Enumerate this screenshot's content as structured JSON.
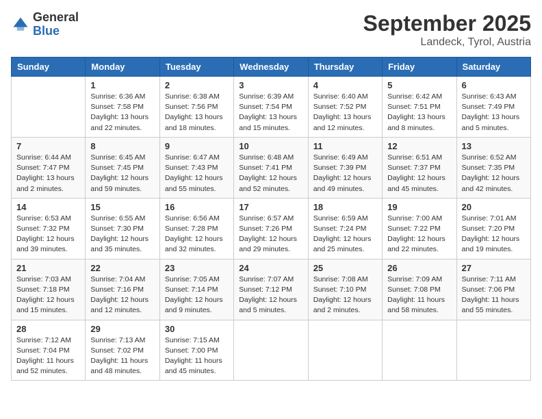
{
  "header": {
    "logo_general": "General",
    "logo_blue": "Blue",
    "month": "September 2025",
    "location": "Landeck, Tyrol, Austria"
  },
  "weekdays": [
    "Sunday",
    "Monday",
    "Tuesday",
    "Wednesday",
    "Thursday",
    "Friday",
    "Saturday"
  ],
  "weeks": [
    [
      {
        "day": "",
        "sunrise": "",
        "sunset": "",
        "daylight": ""
      },
      {
        "day": "1",
        "sunrise": "Sunrise: 6:36 AM",
        "sunset": "Sunset: 7:58 PM",
        "daylight": "Daylight: 13 hours and 22 minutes."
      },
      {
        "day": "2",
        "sunrise": "Sunrise: 6:38 AM",
        "sunset": "Sunset: 7:56 PM",
        "daylight": "Daylight: 13 hours and 18 minutes."
      },
      {
        "day": "3",
        "sunrise": "Sunrise: 6:39 AM",
        "sunset": "Sunset: 7:54 PM",
        "daylight": "Daylight: 13 hours and 15 minutes."
      },
      {
        "day": "4",
        "sunrise": "Sunrise: 6:40 AM",
        "sunset": "Sunset: 7:52 PM",
        "daylight": "Daylight: 13 hours and 12 minutes."
      },
      {
        "day": "5",
        "sunrise": "Sunrise: 6:42 AM",
        "sunset": "Sunset: 7:51 PM",
        "daylight": "Daylight: 13 hours and 8 minutes."
      },
      {
        "day": "6",
        "sunrise": "Sunrise: 6:43 AM",
        "sunset": "Sunset: 7:49 PM",
        "daylight": "Daylight: 13 hours and 5 minutes."
      }
    ],
    [
      {
        "day": "7",
        "sunrise": "Sunrise: 6:44 AM",
        "sunset": "Sunset: 7:47 PM",
        "daylight": "Daylight: 13 hours and 2 minutes."
      },
      {
        "day": "8",
        "sunrise": "Sunrise: 6:45 AM",
        "sunset": "Sunset: 7:45 PM",
        "daylight": "Daylight: 12 hours and 59 minutes."
      },
      {
        "day": "9",
        "sunrise": "Sunrise: 6:47 AM",
        "sunset": "Sunset: 7:43 PM",
        "daylight": "Daylight: 12 hours and 55 minutes."
      },
      {
        "day": "10",
        "sunrise": "Sunrise: 6:48 AM",
        "sunset": "Sunset: 7:41 PM",
        "daylight": "Daylight: 12 hours and 52 minutes."
      },
      {
        "day": "11",
        "sunrise": "Sunrise: 6:49 AM",
        "sunset": "Sunset: 7:39 PM",
        "daylight": "Daylight: 12 hours and 49 minutes."
      },
      {
        "day": "12",
        "sunrise": "Sunrise: 6:51 AM",
        "sunset": "Sunset: 7:37 PM",
        "daylight": "Daylight: 12 hours and 45 minutes."
      },
      {
        "day": "13",
        "sunrise": "Sunrise: 6:52 AM",
        "sunset": "Sunset: 7:35 PM",
        "daylight": "Daylight: 12 hours and 42 minutes."
      }
    ],
    [
      {
        "day": "14",
        "sunrise": "Sunrise: 6:53 AM",
        "sunset": "Sunset: 7:32 PM",
        "daylight": "Daylight: 12 hours and 39 minutes."
      },
      {
        "day": "15",
        "sunrise": "Sunrise: 6:55 AM",
        "sunset": "Sunset: 7:30 PM",
        "daylight": "Daylight: 12 hours and 35 minutes."
      },
      {
        "day": "16",
        "sunrise": "Sunrise: 6:56 AM",
        "sunset": "Sunset: 7:28 PM",
        "daylight": "Daylight: 12 hours and 32 minutes."
      },
      {
        "day": "17",
        "sunrise": "Sunrise: 6:57 AM",
        "sunset": "Sunset: 7:26 PM",
        "daylight": "Daylight: 12 hours and 29 minutes."
      },
      {
        "day": "18",
        "sunrise": "Sunrise: 6:59 AM",
        "sunset": "Sunset: 7:24 PM",
        "daylight": "Daylight: 12 hours and 25 minutes."
      },
      {
        "day": "19",
        "sunrise": "Sunrise: 7:00 AM",
        "sunset": "Sunset: 7:22 PM",
        "daylight": "Daylight: 12 hours and 22 minutes."
      },
      {
        "day": "20",
        "sunrise": "Sunrise: 7:01 AM",
        "sunset": "Sunset: 7:20 PM",
        "daylight": "Daylight: 12 hours and 19 minutes."
      }
    ],
    [
      {
        "day": "21",
        "sunrise": "Sunrise: 7:03 AM",
        "sunset": "Sunset: 7:18 PM",
        "daylight": "Daylight: 12 hours and 15 minutes."
      },
      {
        "day": "22",
        "sunrise": "Sunrise: 7:04 AM",
        "sunset": "Sunset: 7:16 PM",
        "daylight": "Daylight: 12 hours and 12 minutes."
      },
      {
        "day": "23",
        "sunrise": "Sunrise: 7:05 AM",
        "sunset": "Sunset: 7:14 PM",
        "daylight": "Daylight: 12 hours and 9 minutes."
      },
      {
        "day": "24",
        "sunrise": "Sunrise: 7:07 AM",
        "sunset": "Sunset: 7:12 PM",
        "daylight": "Daylight: 12 hours and 5 minutes."
      },
      {
        "day": "25",
        "sunrise": "Sunrise: 7:08 AM",
        "sunset": "Sunset: 7:10 PM",
        "daylight": "Daylight: 12 hours and 2 minutes."
      },
      {
        "day": "26",
        "sunrise": "Sunrise: 7:09 AM",
        "sunset": "Sunset: 7:08 PM",
        "daylight": "Daylight: 11 hours and 58 minutes."
      },
      {
        "day": "27",
        "sunrise": "Sunrise: 7:11 AM",
        "sunset": "Sunset: 7:06 PM",
        "daylight": "Daylight: 11 hours and 55 minutes."
      }
    ],
    [
      {
        "day": "28",
        "sunrise": "Sunrise: 7:12 AM",
        "sunset": "Sunset: 7:04 PM",
        "daylight": "Daylight: 11 hours and 52 minutes."
      },
      {
        "day": "29",
        "sunrise": "Sunrise: 7:13 AM",
        "sunset": "Sunset: 7:02 PM",
        "daylight": "Daylight: 11 hours and 48 minutes."
      },
      {
        "day": "30",
        "sunrise": "Sunrise: 7:15 AM",
        "sunset": "Sunset: 7:00 PM",
        "daylight": "Daylight: 11 hours and 45 minutes."
      },
      {
        "day": "",
        "sunrise": "",
        "sunset": "",
        "daylight": ""
      },
      {
        "day": "",
        "sunrise": "",
        "sunset": "",
        "daylight": ""
      },
      {
        "day": "",
        "sunrise": "",
        "sunset": "",
        "daylight": ""
      },
      {
        "day": "",
        "sunrise": "",
        "sunset": "",
        "daylight": ""
      }
    ]
  ]
}
